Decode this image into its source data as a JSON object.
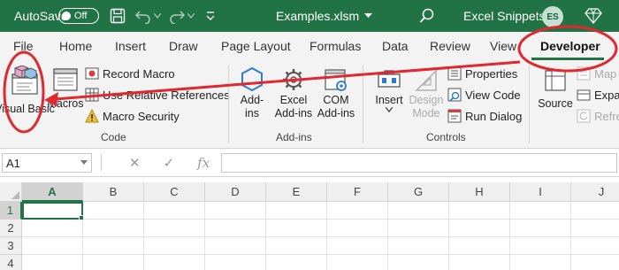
{
  "titlebar": {
    "autosave_label": "AutoSave",
    "autosave_state": "Off",
    "file_name": "Examples.xlsm",
    "user_name": "Excel Snippets",
    "user_initials": "ES",
    "bg_color": "#217346"
  },
  "tabs": [
    {
      "label": "File"
    },
    {
      "label": "Home"
    },
    {
      "label": "Insert"
    },
    {
      "label": "Draw"
    },
    {
      "label": "Page Layout"
    },
    {
      "label": "Formulas"
    },
    {
      "label": "Data"
    },
    {
      "label": "Review"
    },
    {
      "label": "View"
    },
    {
      "label": "Developer",
      "active": true
    }
  ],
  "ribbon": {
    "code": {
      "label": "Code",
      "visual_basic": "Visual Basic",
      "macros": "Macros",
      "record_macro": "Record Macro",
      "use_relative_references": "Use Relative References",
      "macro_security": "Macro Security"
    },
    "addins": {
      "label": "Add-ins",
      "addins_btn": "Add-ins",
      "excel_addins": "Excel Add-ins",
      "com_addins": "COM Add-ins"
    },
    "controls": {
      "label": "Controls",
      "insert": "Insert",
      "design_mode": "Design Mode",
      "properties": "Properties",
      "view_code": "View Code",
      "run_dialog": "Run Dialog"
    },
    "xml": {
      "source": "Source",
      "map_properties": "Map",
      "expansion_packs": "Expa",
      "refresh_data": "Refre"
    }
  },
  "formula_bar": {
    "name_box": "A1",
    "cancel_glyph": "✕",
    "enter_glyph": "✓",
    "fx_glyph": "fx",
    "formula": ""
  },
  "grid": {
    "columns": [
      "A",
      "B",
      "C",
      "D",
      "E",
      "F",
      "G",
      "H",
      "I",
      "J"
    ],
    "rows": [
      "1",
      "2",
      "3",
      "4"
    ],
    "selected_cell": "A1"
  },
  "annotation_color": "#e0282e",
  "accent": "#217346"
}
